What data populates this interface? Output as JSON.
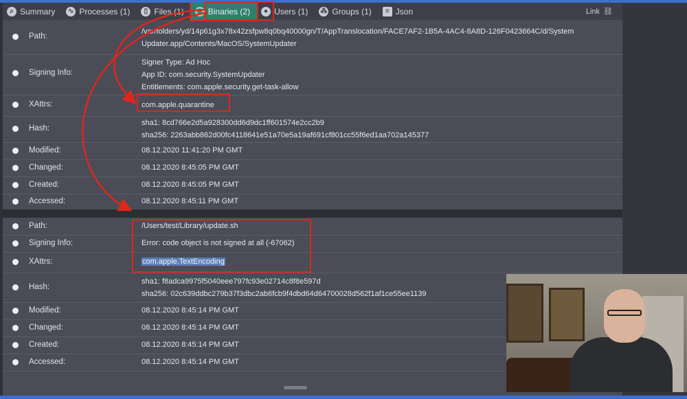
{
  "tabs": [
    {
      "label": "Summary",
      "icon": "magnifier-icon"
    },
    {
      "label": "Processes (1)",
      "icon": "activity-icon"
    },
    {
      "label": "Files (1)",
      "icon": "file-icon"
    },
    {
      "label": "Binaries (2)",
      "icon": "binary-icon",
      "active": true
    },
    {
      "label": "Users (1)",
      "icon": "user-icon"
    },
    {
      "label": "Groups (1)",
      "icon": "group-icon"
    },
    {
      "label": "Json",
      "icon": "document-icon"
    }
  ],
  "link_label": "Link",
  "binaries": [
    {
      "path_key": "Path:",
      "path": [
        "/var/folders/yd/14p61g3x78x42zsfpw8q0bq40000gn/T/AppTranslocation/FACE7AF2-1B5A-4AC4-8A8D-126F0423664C/d/System",
        "Updater.app/Contents/MacOS/SystemUpdater"
      ],
      "signing_key": "Signing Info:",
      "signing": [
        "Signer Type: Ad Hoc",
        "App ID: com.security.SystemUpdater",
        "Entitlements: com.apple.security.get-task-allow"
      ],
      "xattrs_key": "XAttrs:",
      "xattrs": "com.apple.quarantine",
      "hash_key": "Hash:",
      "hash": [
        "sha1: 8cd766e2d5a928300dd6d9dc1ff601574e2cc2b9",
        "sha256: 2263abb862d00fc4118641e51a70e5a19af691cf801cc55f6ed1aa702a145377"
      ],
      "modified_key": "Modified:",
      "modified": "08.12.2020 11:41:20 PM GMT",
      "changed_key": "Changed:",
      "changed": "08.12.2020 8:45:05 PM GMT",
      "created_key": "Created:",
      "created": "08.12.2020 8:45:05 PM GMT",
      "accessed_key": "Accessed:",
      "accessed": "08.12.2020 8:45:11 PM GMT"
    },
    {
      "path_key": "Path:",
      "path": "/Users/test/Library/update.sh",
      "signing_key": "Signing Info:",
      "signing": "Error: code object is not signed at all (-67062)",
      "xattrs_key": "XAttrs:",
      "xattrs": "com.apple.TextEncoding",
      "hash_key": "Hash:",
      "hash": [
        "sha1: f8adca9975f5040eee797fc93e02714c8f8e597d",
        "sha256: 02c639ddbc279b37f3dbc2ab6fcb9f4dbd64d64700028d562f1af1ce55ee1139"
      ],
      "modified_key": "Modified:",
      "modified": "08.12.2020 8:45:14 PM GMT",
      "changed_key": "Changed:",
      "changed": "08.12.2020 8:45:14 PM GMT",
      "created_key": "Created:",
      "created": "08.12.2020 8:45:14 PM GMT",
      "accessed_key": "Accessed:",
      "accessed": "08.12.2020 8:45:14 PM GMT"
    }
  ],
  "colors": {
    "accent_tab": "#2e7f6b",
    "annotation_red": "#e0251b",
    "error_text": "#4fc0a8",
    "selection": "#5b7fb8"
  }
}
